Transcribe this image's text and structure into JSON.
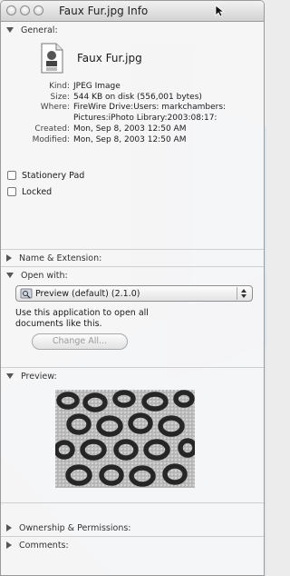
{
  "window": {
    "title": "Faux Fur.jpg Info"
  },
  "general": {
    "heading": "General:",
    "file_name": "Faux Fur.jpg",
    "rows": [
      {
        "key": "Kind:",
        "value": "JPEG Image"
      },
      {
        "key": "Size:",
        "value": "544 KB on disk (556,001 bytes)"
      },
      {
        "key": "Where:",
        "value": "FireWire Drive:Users: markchambers:Pictures:iPhoto Library:2003:08:17:"
      },
      {
        "key": "Created:",
        "value": "Mon, Sep 8, 2003 12:50 AM"
      },
      {
        "key": "Modified:",
        "value": "Mon, Sep 8, 2003 12:50 AM"
      }
    ],
    "stationery_label": "Stationery Pad",
    "locked_label": "Locked"
  },
  "name_extension": {
    "heading": "Name & Extension:"
  },
  "open_with": {
    "heading": "Open with:",
    "selected_app": "Preview (default) (2.1.0)",
    "description": "Use this application to open all documents like this.",
    "change_all_label": "Change All..."
  },
  "preview": {
    "heading": "Preview:"
  },
  "ownership": {
    "heading": "Ownership & Permissions:"
  },
  "comments": {
    "heading": "Comments:"
  },
  "icons": {
    "close": "close-icon",
    "minimize": "minimize-icon",
    "zoom": "zoom-icon",
    "file": "jpeg-file-icon",
    "app": "preview-app-icon",
    "popup": "popup-arrows-icon",
    "cursor": "mouse-cursor-icon"
  },
  "colors": {
    "window_bg": "#f6f6f8",
    "disabled_text": "#9a9a9a",
    "border": "#9a9a9a"
  }
}
